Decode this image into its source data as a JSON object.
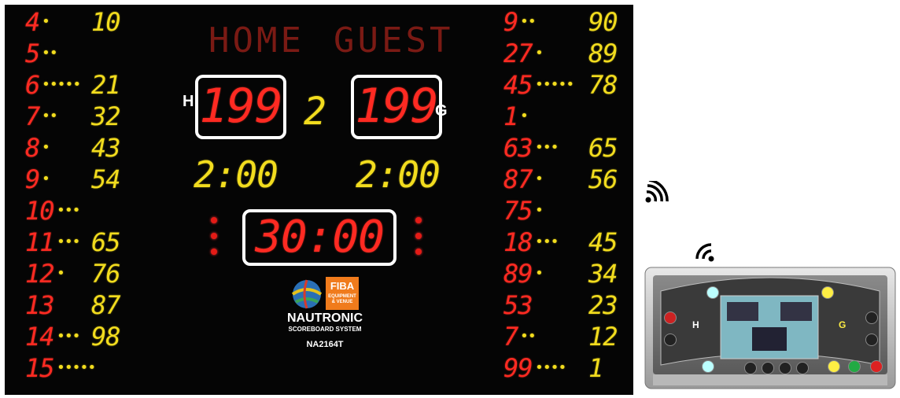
{
  "scoreboard": {
    "header": {
      "home": "HOME",
      "guest": "GUEST"
    },
    "home_score": "199",
    "guest_score": "199",
    "home_letter": "H",
    "guest_letter": "G",
    "period": "2",
    "home_timeout": "2:00",
    "guest_timeout": "2:00",
    "game_clock": "30:00",
    "left_players": [
      {
        "num": "4",
        "dots": "•",
        "pts": "10"
      },
      {
        "num": "5",
        "dots": "••",
        "pts": ""
      },
      {
        "num": "6",
        "dots": "•••••",
        "pts": "21"
      },
      {
        "num": "7",
        "dots": "••",
        "pts": "32"
      },
      {
        "num": "8",
        "dots": "•",
        "pts": "43"
      },
      {
        "num": "9",
        "dots": "•",
        "pts": "54"
      },
      {
        "num": "10",
        "dots": "•••",
        "pts": ""
      },
      {
        "num": "11",
        "dots": "•••",
        "pts": "65"
      },
      {
        "num": "12",
        "dots": "•",
        "pts": "76"
      },
      {
        "num": "13",
        "dots": "",
        "pts": "87"
      },
      {
        "num": "14",
        "dots": "•••",
        "pts": "98"
      },
      {
        "num": "15",
        "dots": "•••••",
        "pts": ""
      }
    ],
    "right_players": [
      {
        "num": "9",
        "dots": "••",
        "pts": "90"
      },
      {
        "num": "27",
        "dots": "•",
        "pts": "89"
      },
      {
        "num": "45",
        "dots": "•••••",
        "pts": "78"
      },
      {
        "num": "1",
        "dots": "•",
        "pts": ""
      },
      {
        "num": "63",
        "dots": "•••",
        "pts": "65"
      },
      {
        "num": "87",
        "dots": "•",
        "pts": "56"
      },
      {
        "num": "75",
        "dots": "•",
        "pts": ""
      },
      {
        "num": "18",
        "dots": "•••",
        "pts": "45"
      },
      {
        "num": "89",
        "dots": "•",
        "pts": "34"
      },
      {
        "num": "53",
        "dots": "",
        "pts": "23"
      },
      {
        "num": "7",
        "dots": "••",
        "pts": "12"
      },
      {
        "num": "99",
        "dots": "••••",
        "pts": "1"
      }
    ],
    "brand": {
      "fiba_line1": "FIBA",
      "fiba_line2": "EQUIPMENT & VENUE",
      "name": "NAUTRONIC",
      "subtitle": "SCOREBOARD SYSTEM",
      "model": "NA2164T"
    }
  },
  "console": {
    "home_letter": "H",
    "guest_letter": "G"
  },
  "colors": {
    "red": "#ff2a22",
    "yellow": "#f2dc1e",
    "board": "#050505",
    "fiba_orange": "#f07b1c"
  },
  "icons": [
    "wireless-signal-icon",
    "wifi-signal-icon",
    "basketball-logo-icon",
    "fiba-logo-icon"
  ]
}
